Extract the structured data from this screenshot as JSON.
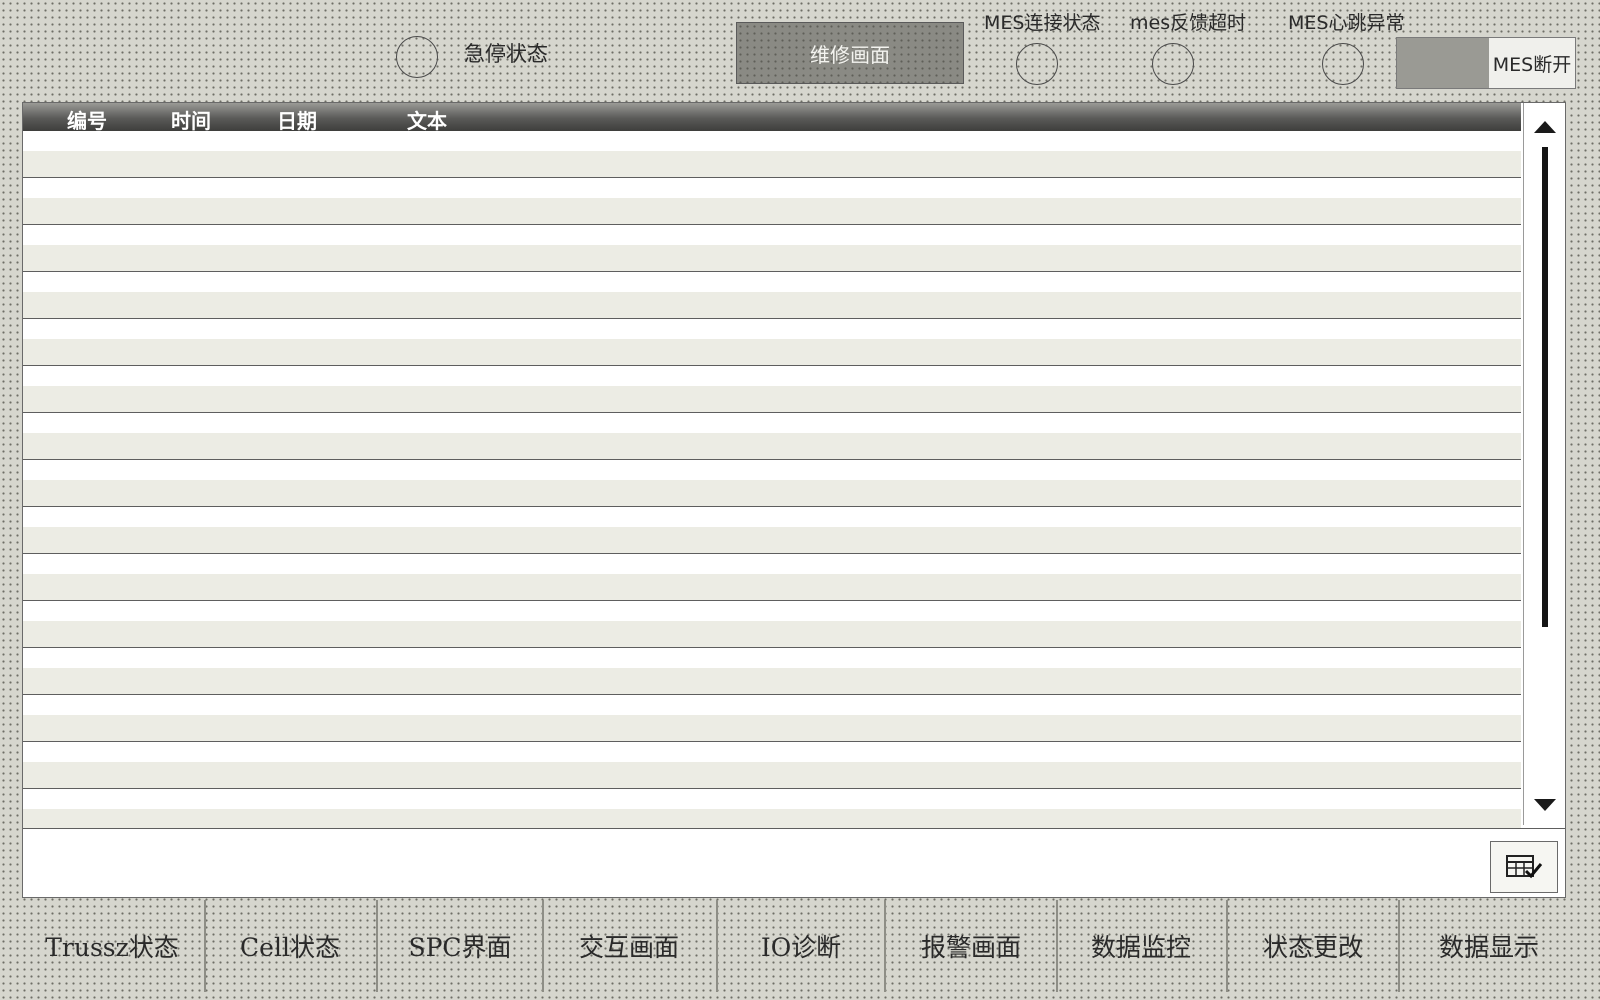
{
  "top_bar": {
    "estop_label": "急停状态",
    "maintenance_button": "维修画面",
    "mes_connection_label": "MES连接状态",
    "mes_timeout_label": "mes反馈超时",
    "mes_heartbeat_label": "MES心跳异常",
    "mes_toggle_label": "MES断开"
  },
  "table": {
    "columns": [
      "编号",
      "时间",
      "日期",
      "文本"
    ],
    "row_count": 15
  },
  "nav": {
    "items": [
      "Trussz状态",
      "Cell状态",
      "SPC界面",
      "交互画面",
      "IO诊断",
      "报警画面",
      "数据监控",
      "状态更改",
      "数据显示"
    ]
  }
}
